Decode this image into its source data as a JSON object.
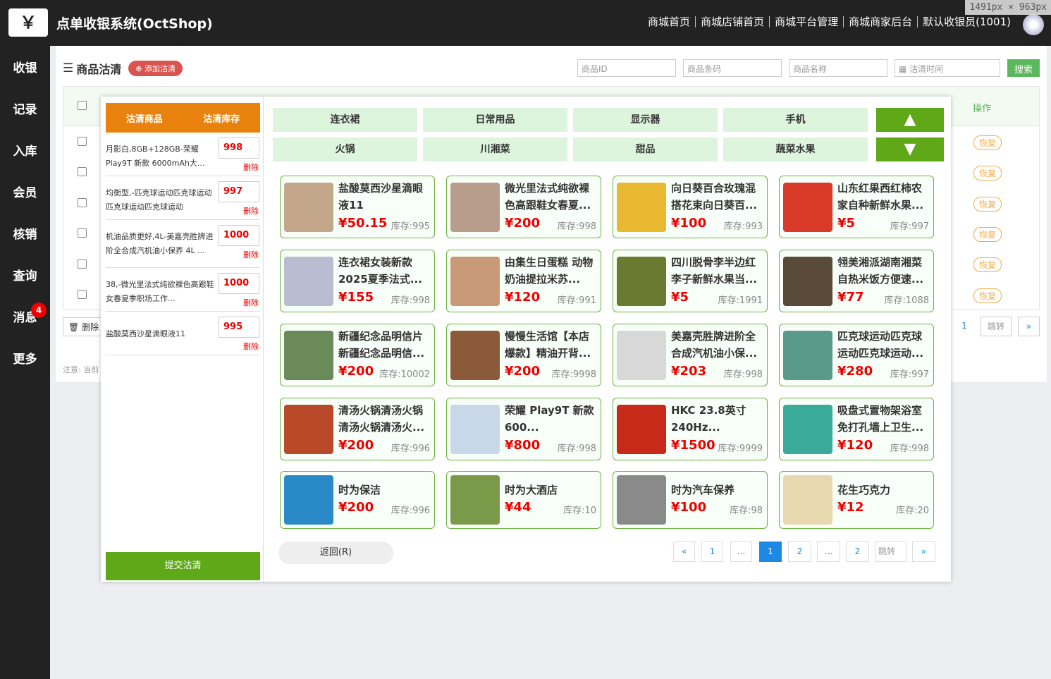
{
  "app": {
    "logo": "￥",
    "title": "点单收银系统(OctShop)"
  },
  "topnav": [
    "商城首页",
    "商城店铺首页",
    "商城平台管理",
    "商城商家后台",
    "默认收银员(1001)"
  ],
  "dimension_label": "1491px × 963px",
  "sidebar": [
    {
      "label": "收银"
    },
    {
      "label": "记录"
    },
    {
      "label": "入库"
    },
    {
      "label": "会员"
    },
    {
      "label": "核销"
    },
    {
      "label": "查询"
    },
    {
      "label": "消息",
      "badge": "4"
    },
    {
      "label": "更多"
    }
  ],
  "page": {
    "icon": "list-icon",
    "title": "商品沽清",
    "add_button": "添加沽清",
    "filters": {
      "id": "商品ID",
      "barcode": "商品条码",
      "name": "商品名称",
      "time": "沽清时间",
      "search": "搜索"
    },
    "ops_header": "操作",
    "restore_label": "恢复",
    "delete_label": "删除",
    "note": "注意: 当前",
    "pager": {
      "page": "1",
      "jump": "跳转",
      "next": "»"
    }
  },
  "modal": {
    "left_header": {
      "goods": "沽清商品",
      "stock": "沽清库存"
    },
    "delete_label": "删除",
    "submit": "提交沽清",
    "back": "返回(R)",
    "items": [
      {
        "name": "月影白,8GB+128GB-荣耀Play9T 新款 6000mAh大...",
        "qty": "998"
      },
      {
        "name": "均衡型,-匹克球运动匹克球运动匹克球运动匹克球运动",
        "qty": "997"
      },
      {
        "name": "机油品质更好,4L-美嘉壳胜牌进阶全合成汽机油小保养 4L ...",
        "qty": "1000"
      },
      {
        "name": "38,-微光里法式纯欲裸色高跟鞋女春夏季职场工作...",
        "qty": "1000"
      },
      {
        "name": "盐酸莫西沙星滴眼液11",
        "qty": "995"
      }
    ],
    "categories": [
      "连衣裙",
      "日常用品",
      "显示器",
      "手机",
      "火锅",
      "川湘菜",
      "甜品",
      "蔬菜水果"
    ],
    "arrows": {
      "up": "▲",
      "down": "▼"
    },
    "products": [
      {
        "title": "盐酸莫西沙星滴眼液11",
        "price": "¥50.15",
        "stock": "库存:995",
        "color": "#c4a68a"
      },
      {
        "title": "微光里法式纯欲裸色高跟鞋女春夏...",
        "price": "¥200",
        "stock": "库存:998",
        "color": "#b89c8c"
      },
      {
        "title": "向日葵百合玫瑰混搭花束向日葵百...",
        "price": "¥100",
        "stock": "库存:993",
        "color": "#e8b830"
      },
      {
        "title": "山东红果西红柿农家自种新鲜水果...",
        "price": "¥5",
        "stock": "库存:997",
        "color": "#d93a2a"
      },
      {
        "title": "连衣裙女装新款2025夏季法式...",
        "price": "¥155",
        "stock": "库存:998",
        "color": "#b8bcd0"
      },
      {
        "title": "由集生日蛋糕 动物奶油提拉米苏...",
        "price": "¥120",
        "stock": "库存:991",
        "color": "#c89a78"
      },
      {
        "title": "四川脱骨李半边红李子新鲜水果当...",
        "price": "¥5",
        "stock": "库存:1991",
        "color": "#6a7a30"
      },
      {
        "title": "翎美湘派湖南湘菜自热米饭方便速...",
        "price": "¥77",
        "stock": "库存:1088",
        "color": "#5a4a3a"
      },
      {
        "title": "新疆纪念品明信片新疆纪念品明信...",
        "price": "¥200",
        "stock": "库存:10002",
        "color": "#6a8a5a"
      },
      {
        "title": "慢慢生活馆【本店爆款】精油开背...",
        "price": "¥200",
        "stock": "库存:9998",
        "color": "#8a5a3a"
      },
      {
        "title": "美嘉壳胜牌进阶全合成汽机油小保...",
        "price": "¥203",
        "stock": "库存:998",
        "color": "#d8d8d8"
      },
      {
        "title": "匹克球运动匹克球运动匹克球运动...",
        "price": "¥280",
        "stock": "库存:997",
        "color": "#5a9a8a"
      },
      {
        "title": "清汤火锅清汤火锅清汤火锅清汤火...",
        "price": "¥200",
        "stock": "库存:996",
        "color": "#b84a2a"
      },
      {
        "title": "荣耀 Play9T 新款 600...",
        "price": "¥800",
        "stock": "库存:998",
        "color": "#c8d8e8"
      },
      {
        "title": "HKC 23.8英寸 240Hz...",
        "price": "¥1500",
        "stock": "库存:9999",
        "color": "#c82a1a"
      },
      {
        "title": "吸盘式置物架浴室免打孔墙上卫生...",
        "price": "¥120",
        "stock": "库存:998",
        "color": "#3aaa9a"
      },
      {
        "title": "时为保洁",
        "price": "¥200",
        "stock": "库存:996",
        "color": "#2a8ac8"
      },
      {
        "title": "时为大酒店",
        "price": "¥44",
        "stock": "库存:10",
        "color": "#7a9a4a"
      },
      {
        "title": "时为汽车保养",
        "price": "¥100",
        "stock": "库存:98",
        "color": "#8a8a8a"
      },
      {
        "title": "花生巧克力",
        "price": "¥12",
        "stock": "库存:20",
        "color": "#e8d8b0"
      }
    ],
    "pager": [
      "«",
      "1",
      "...",
      "1",
      "2",
      "...",
      "2",
      "跳转",
      "»"
    ],
    "current_page": "1"
  }
}
